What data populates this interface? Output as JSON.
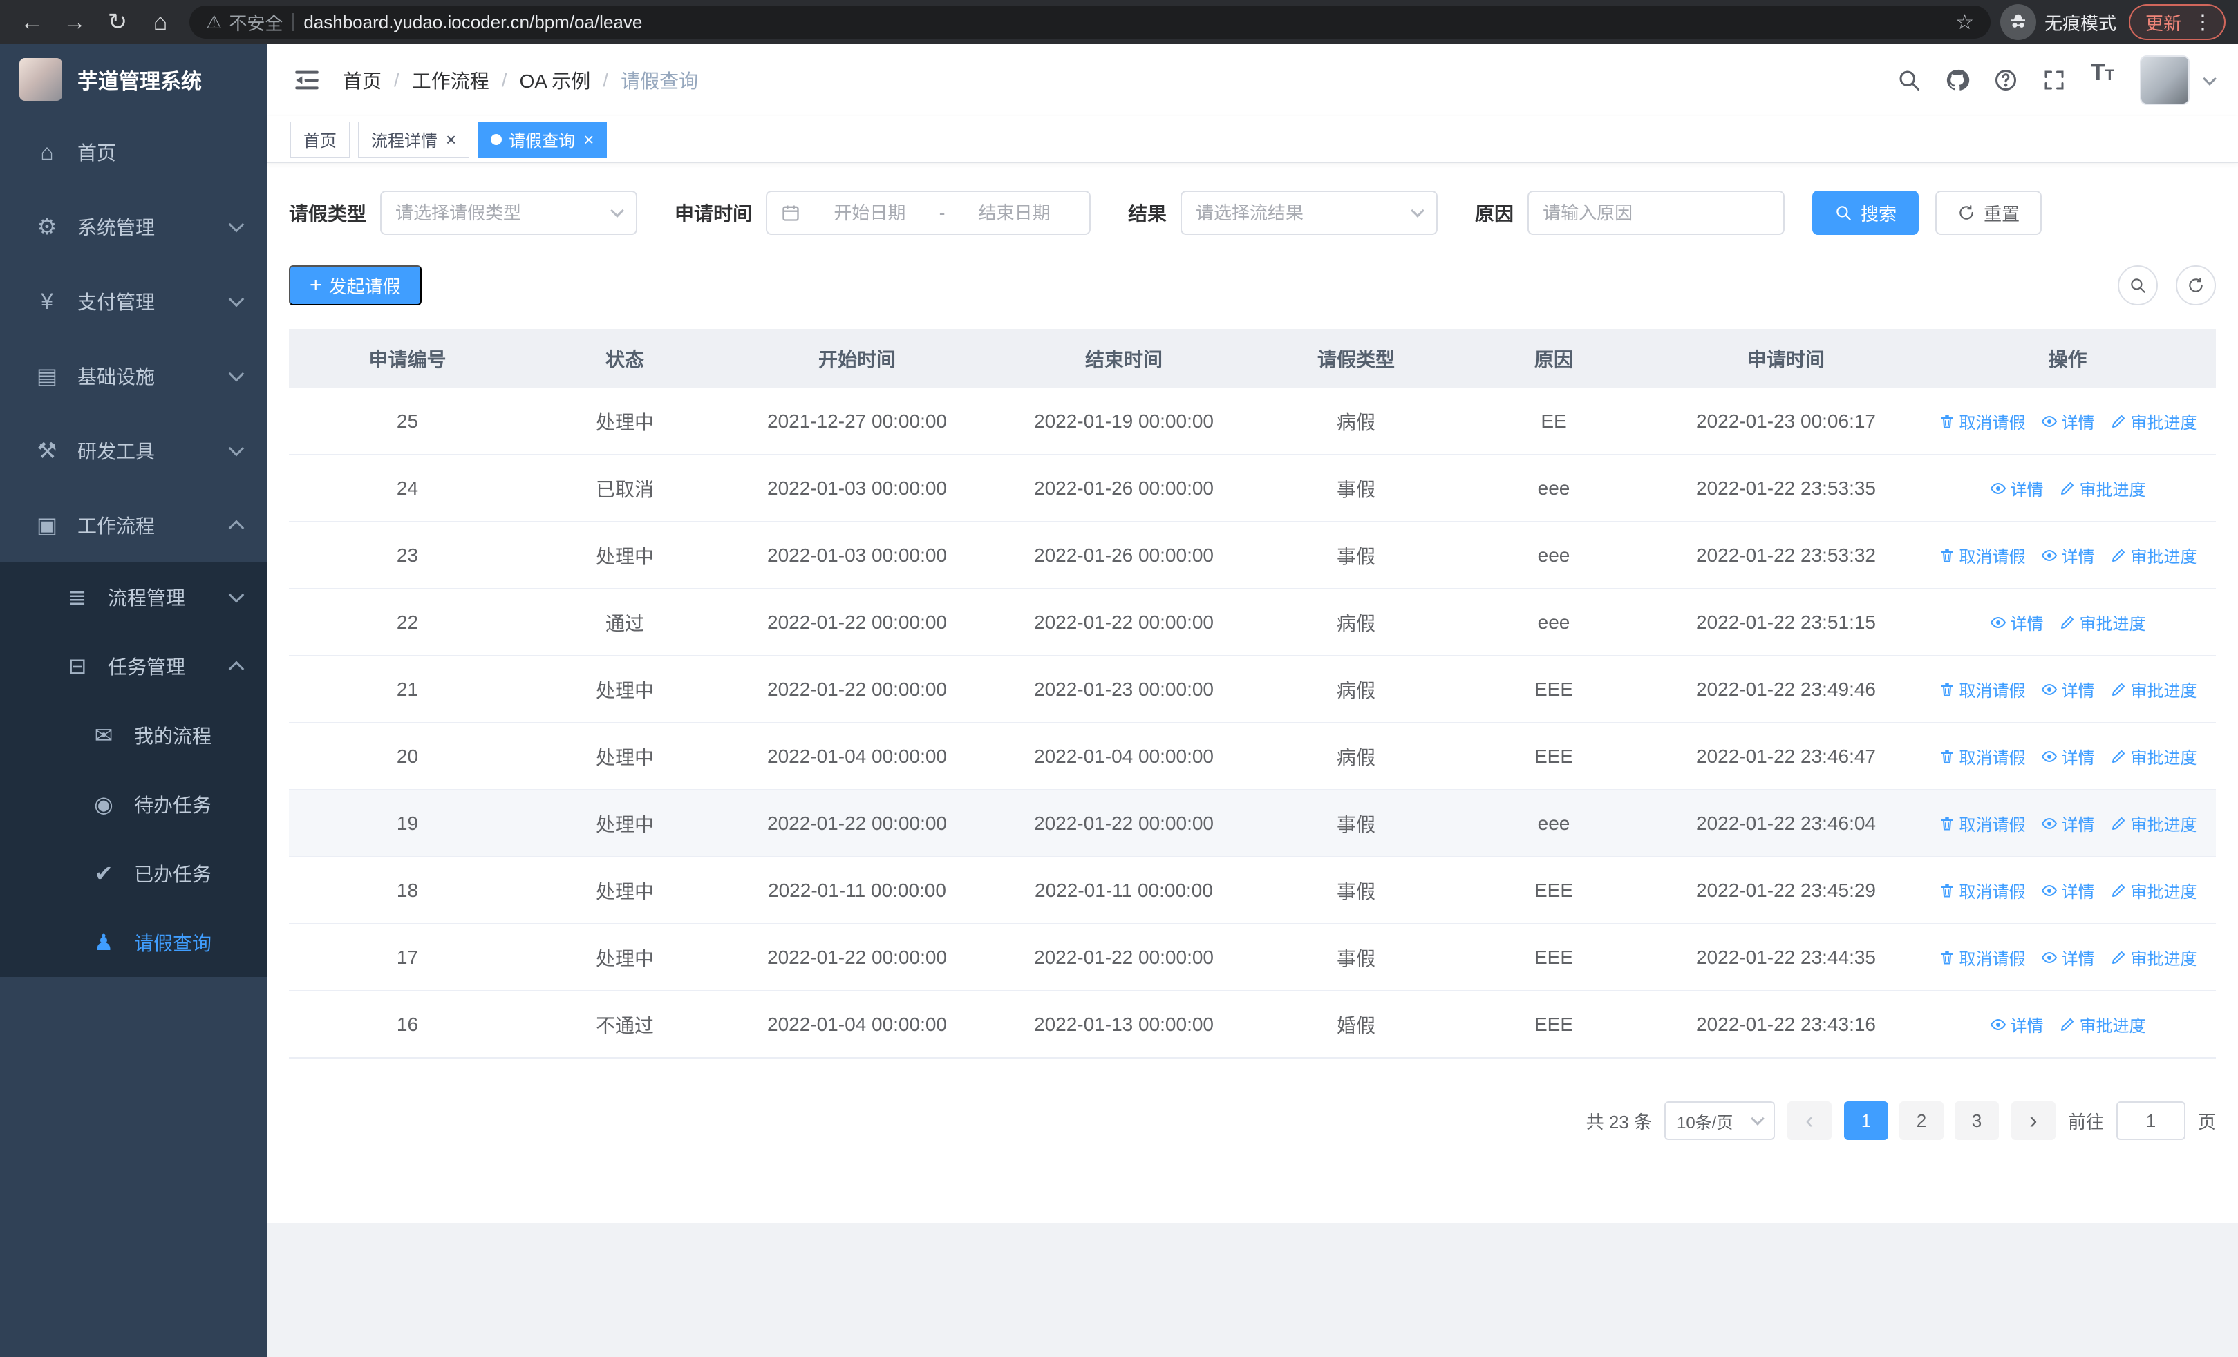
{
  "browser": {
    "nav_icons": [
      "back-icon",
      "forward-icon",
      "reload-icon",
      "home-icon"
    ],
    "security_warning": "不安全",
    "url": "dashboard.yudao.iocoder.cn/bpm/oa/leave",
    "incognito_label": "无痕模式",
    "update_label": "更新"
  },
  "sidebar": {
    "app_title": "芋道管理系统",
    "menu": [
      {
        "name": "home",
        "label": "首页",
        "icon": "home-icon",
        "level": 1
      },
      {
        "name": "system",
        "label": "系统管理",
        "icon": "gear-icon",
        "level": 1,
        "arrow": "down"
      },
      {
        "name": "payment",
        "label": "支付管理",
        "icon": "yen-icon",
        "level": 1,
        "arrow": "down"
      },
      {
        "name": "infrastructure",
        "label": "基础设施",
        "icon": "infra-icon",
        "level": 1,
        "arrow": "down"
      },
      {
        "name": "devtools",
        "label": "研发工具",
        "icon": "tools-icon",
        "level": 1,
        "arrow": "down"
      },
      {
        "name": "workflow",
        "label": "工作流程",
        "icon": "workflow-icon",
        "level": 1,
        "arrow": "up"
      },
      {
        "name": "process-mgmt",
        "label": "流程管理",
        "icon": "process-icon",
        "level": 2,
        "arrow": "down"
      },
      {
        "name": "task-mgmt",
        "label": "任务管理",
        "icon": "task-icon",
        "level": 2,
        "arrow": "up"
      },
      {
        "name": "my-process",
        "label": "我的流程",
        "icon": "message-icon",
        "level": 3
      },
      {
        "name": "todo-tasks",
        "label": "待办任务",
        "icon": "eye-round-icon",
        "level": 3
      },
      {
        "name": "done-tasks",
        "label": "已办任务",
        "icon": "check-icon",
        "level": 3
      },
      {
        "name": "leave-query",
        "label": "请假查询",
        "icon": "user-icon",
        "level": 3,
        "active": true
      }
    ]
  },
  "header": {
    "breadcrumb": [
      "首页",
      "工作流程",
      "OA 示例",
      "请假查询"
    ],
    "icons": [
      "search-icon",
      "github-icon",
      "question-icon",
      "fullscreen-icon"
    ]
  },
  "tabs": [
    {
      "name": "home",
      "label": "首页"
    },
    {
      "name": "process-detail",
      "label": "流程详情",
      "closable": true
    },
    {
      "name": "leave-query",
      "label": "请假查询",
      "closable": true,
      "active": true
    }
  ],
  "filters": {
    "leave_type_label": "请假类型",
    "leave_type_placeholder": "请选择请假类型",
    "apply_time_label": "申请时间",
    "start_date_placeholder": "开始日期",
    "range_separator": "-",
    "end_date_placeholder": "结束日期",
    "result_label": "结果",
    "result_placeholder": "请选择流结果",
    "reason_label": "原因",
    "reason_placeholder": "请输入原因",
    "search_button": "搜索",
    "reset_button": "重置"
  },
  "toolbar": {
    "create_button": "发起请假"
  },
  "table": {
    "columns": [
      "申请编号",
      "状态",
      "开始时间",
      "结束时间",
      "请假类型",
      "原因",
      "申请时间",
      "操作"
    ],
    "action_labels": {
      "cancel": "取消请假",
      "detail": "详情",
      "progress": "审批进度"
    },
    "rows": [
      {
        "id": "25",
        "status": "处理中",
        "start": "2021-12-27 00:00:00",
        "end": "2022-01-19 00:00:00",
        "type": "病假",
        "reason": "EE",
        "apply_time": "2022-01-23 00:06:17",
        "actions": [
          "cancel",
          "detail",
          "progress"
        ]
      },
      {
        "id": "24",
        "status": "已取消",
        "start": "2022-01-03 00:00:00",
        "end": "2022-01-26 00:00:00",
        "type": "事假",
        "reason": "eee",
        "apply_time": "2022-01-22 23:53:35",
        "actions": [
          "detail",
          "progress"
        ]
      },
      {
        "id": "23",
        "status": "处理中",
        "start": "2022-01-03 00:00:00",
        "end": "2022-01-26 00:00:00",
        "type": "事假",
        "reason": "eee",
        "apply_time": "2022-01-22 23:53:32",
        "actions": [
          "cancel",
          "detail",
          "progress"
        ]
      },
      {
        "id": "22",
        "status": "通过",
        "start": "2022-01-22 00:00:00",
        "end": "2022-01-22 00:00:00",
        "type": "病假",
        "reason": "eee",
        "apply_time": "2022-01-22 23:51:15",
        "actions": [
          "detail",
          "progress"
        ]
      },
      {
        "id": "21",
        "status": "处理中",
        "start": "2022-01-22 00:00:00",
        "end": "2022-01-23 00:00:00",
        "type": "病假",
        "reason": "EEE",
        "apply_time": "2022-01-22 23:49:46",
        "actions": [
          "cancel",
          "detail",
          "progress"
        ]
      },
      {
        "id": "20",
        "status": "处理中",
        "start": "2022-01-04 00:00:00",
        "end": "2022-01-04 00:00:00",
        "type": "病假",
        "reason": "EEE",
        "apply_time": "2022-01-22 23:46:47",
        "actions": [
          "cancel",
          "detail",
          "progress"
        ]
      },
      {
        "id": "19",
        "status": "处理中",
        "start": "2022-01-22 00:00:00",
        "end": "2022-01-22 00:00:00",
        "type": "事假",
        "reason": "eee",
        "apply_time": "2022-01-22 23:46:04",
        "actions": [
          "cancel",
          "detail",
          "progress"
        ],
        "highlight": true
      },
      {
        "id": "18",
        "status": "处理中",
        "start": "2022-01-11 00:00:00",
        "end": "2022-01-11 00:00:00",
        "type": "事假",
        "reason": "EEE",
        "apply_time": "2022-01-22 23:45:29",
        "actions": [
          "cancel",
          "detail",
          "progress"
        ]
      },
      {
        "id": "17",
        "status": "处理中",
        "start": "2022-01-22 00:00:00",
        "end": "2022-01-22 00:00:00",
        "type": "事假",
        "reason": "EEE",
        "apply_time": "2022-01-22 23:44:35",
        "actions": [
          "cancel",
          "detail",
          "progress"
        ]
      },
      {
        "id": "16",
        "status": "不通过",
        "start": "2022-01-04 00:00:00",
        "end": "2022-01-13 00:00:00",
        "type": "婚假",
        "reason": "EEE",
        "apply_time": "2022-01-22 23:43:16",
        "actions": [
          "detail",
          "progress"
        ]
      }
    ]
  },
  "pagination": {
    "total_text": "共 23 条",
    "page_size": "10条/页",
    "pages": [
      "1",
      "2",
      "3"
    ],
    "active_page": "1",
    "goto_label": "前往",
    "goto_value": "1",
    "goto_suffix": "页"
  },
  "colors": {
    "primary": "#409eff",
    "sidebar_bg": "#304156",
    "submenu_bg": "#1f2d3d"
  }
}
